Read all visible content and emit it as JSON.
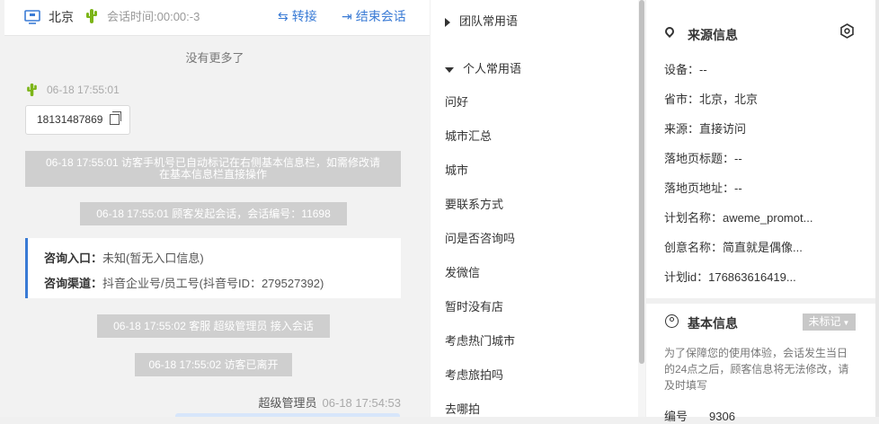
{
  "chat": {
    "header": {
      "city": "北京",
      "session_time_label": "会话时间:",
      "session_time": "00:00:-3",
      "transfer": "转接",
      "end": "结束会话"
    },
    "no_more": "没有更多了",
    "visitor_time": "06-18 17:55:01",
    "phone": "18131487869",
    "sys1_line1": "06-18 17:55:01 访客手机号已自动标记在右侧基本信息栏，如需修改请",
    "sys1_line2": "在基本信息栏直接操作",
    "sys2": "06-18 17:55:01 顾客发起会话，会话编号：11698",
    "consult_entry_label": "咨询入口：",
    "consult_entry": "未知(暂无入口信息)",
    "consult_channel_label": "咨询渠道：",
    "consult_channel": "抖音企业号/员工号(抖音号ID：279527392)",
    "sys3": "06-18 17:55:02 客服 超级管理员 接入会话",
    "sys4": "06-18 17:55:02 访客已离开",
    "agent_name": "超级管理员",
    "agent_time": "06-18 17:54:53"
  },
  "phrases": {
    "team_group": "团队常用语",
    "personal_group": "个人常用语",
    "items": [
      "问好",
      "城市汇总",
      "城市",
      "要联系方式",
      "问是否咨询吗",
      "发微信",
      "暂时没有店",
      "考虑热门城市",
      "考虑旅拍吗",
      "去哪拍"
    ]
  },
  "info": {
    "source_title": "来源信息",
    "device": "设备：--",
    "province": "省市：北京，北京",
    "source": "来源：直接访问",
    "landing_title": "落地页标题：--",
    "landing_url": "落地页地址：--",
    "plan_name": "计划名称：aweme_promot...",
    "creative_name": "创意名称：简直就是偶像...",
    "plan_id": "计划id：176863616419...",
    "basic_title": "基本信息",
    "tag": "未标记",
    "note": "为了保障您的使用体验，会话发生当日的24点之后，顾客信息将无法修改，请及时填写",
    "number_label": "编号",
    "number": "9306"
  },
  "colors": {
    "accent": "#3a7bd5",
    "system_bubble": "#cfcfcf",
    "cactus": "#7cb518"
  }
}
